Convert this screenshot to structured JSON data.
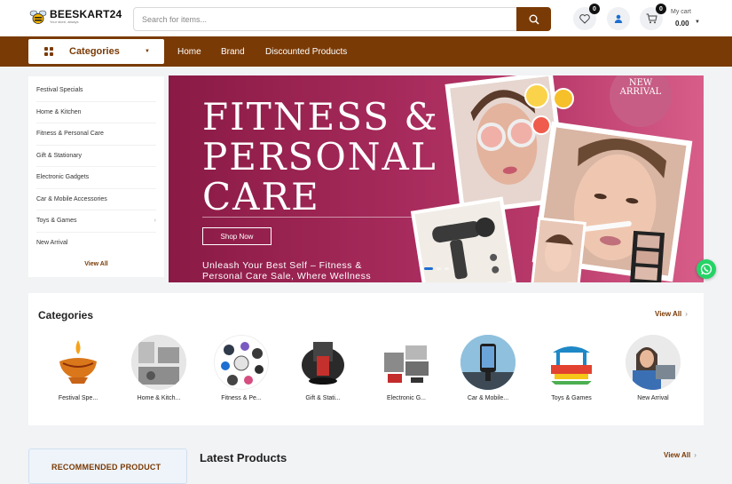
{
  "header": {
    "logo_text": "BEESKART24",
    "logo_tagline": "Your store, always",
    "search_placeholder": "Search for items...",
    "wishlist_count": "0",
    "cart_count": "0",
    "cart_label": "My cart",
    "cart_total": "0.00"
  },
  "nav": {
    "categories_label": "Categories",
    "links": [
      "Home",
      "Brand",
      "Discounted Products"
    ]
  },
  "sidebar": {
    "items": [
      {
        "label": "Festival Specials"
      },
      {
        "label": "Home & Kitchen"
      },
      {
        "label": "Fitness & Personal Care"
      },
      {
        "label": "Gift & Stationary"
      },
      {
        "label": "Electronic Gadgets"
      },
      {
        "label": "Car & Mobile Accessories"
      },
      {
        "label": "Toys & Games"
      },
      {
        "label": "New Arrival"
      }
    ],
    "view_all": "View All"
  },
  "banner": {
    "title_line1": "FITNESS &",
    "title_line2": "PERSONAL",
    "title_line3": "CARE",
    "button": "Shop Now",
    "subtitle_line1": "Unleash Your Best Self – Fitness &",
    "subtitle_line2": "Personal Care Sale, Where Wellness",
    "stamp_line1": "NEW",
    "stamp_line2": "ARRIVAL"
  },
  "categories": {
    "title": "Categories",
    "view_all": "View All",
    "items": [
      {
        "label": "Festival Spe..."
      },
      {
        "label": "Home & Kitch..."
      },
      {
        "label": "Fitness & Pe..."
      },
      {
        "label": "Gift & Stati..."
      },
      {
        "label": "Electronic G..."
      },
      {
        "label": "Car & Mobile..."
      },
      {
        "label": "Toys & Games"
      },
      {
        "label": "New Arrival"
      }
    ]
  },
  "recommended": {
    "label": "RECOMMENDED PRODUCT"
  },
  "latest": {
    "title": "Latest Products",
    "view_all": "View All"
  },
  "colors": {
    "brand": "#7a3a05",
    "banner": "#a72b5c",
    "whatsapp": "#25d366"
  }
}
